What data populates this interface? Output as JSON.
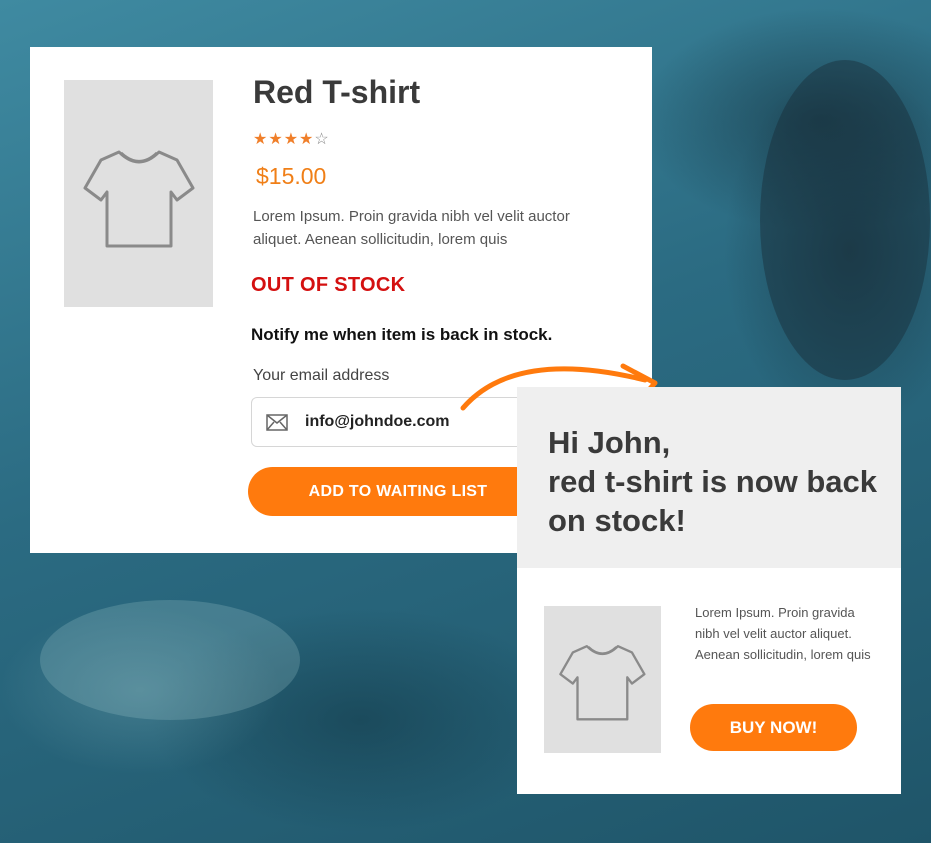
{
  "product": {
    "title": "Red T-shirt",
    "rating": 4,
    "rating_max": 5,
    "price": "$15.00",
    "description": "Lorem Ipsum. Proin gravida nibh vel velit auctor aliquet. Aenean sollicitudin, lorem quis",
    "stock_status": "OUT OF STOCK",
    "notify_heading": "Notify me when item is back in stock.",
    "email_label": "Your email address",
    "email_value": "info@johndoe.com",
    "button_label": "ADD TO WAITING LIST",
    "image_icon": "tshirt-icon"
  },
  "notification": {
    "greeting": "Hi John,\nred t-shirt is now back on stock!",
    "description": "Lorem Ipsum. Proin gravida nibh vel velit auctor aliquet. Aenean sollicitudin, lorem quis",
    "button_label": "BUY NOW!",
    "image_icon": "tshirt-icon"
  },
  "colors": {
    "accent": "#ff7a0d",
    "out_of_stock": "#d41010",
    "background": "#2f6f86"
  }
}
